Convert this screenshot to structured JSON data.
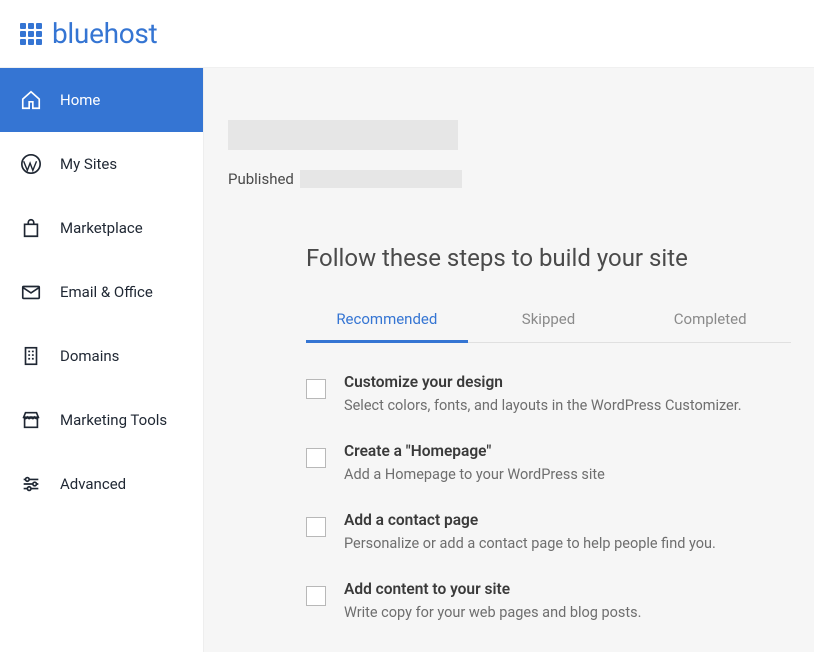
{
  "header": {
    "brand": "bluehost"
  },
  "sidebar": {
    "items": [
      {
        "label": "Home",
        "icon": "home-icon",
        "active": true
      },
      {
        "label": "My Sites",
        "icon": "wordpress-icon",
        "active": false
      },
      {
        "label": "Marketplace",
        "icon": "bag-icon",
        "active": false
      },
      {
        "label": "Email & Office",
        "icon": "envelope-icon",
        "active": false
      },
      {
        "label": "Domains",
        "icon": "building-icon",
        "active": false
      },
      {
        "label": "Marketing Tools",
        "icon": "storefront-icon",
        "active": false
      },
      {
        "label": "Advanced",
        "icon": "sliders-icon",
        "active": false
      }
    ]
  },
  "main": {
    "published_label": "Published",
    "steps_heading": "Follow these steps to build your site",
    "tabs": [
      {
        "label": "Recommended",
        "active": true
      },
      {
        "label": "Skipped",
        "active": false
      },
      {
        "label": "Completed",
        "active": false
      }
    ],
    "tasks": [
      {
        "title": "Customize your design",
        "desc": "Select colors, fonts, and layouts in the WordPress Customizer."
      },
      {
        "title": "Create a \"Homepage\"",
        "desc": "Add a Homepage to your WordPress site"
      },
      {
        "title": "Add a contact page",
        "desc": "Personalize or add a contact page to help people find you."
      },
      {
        "title": "Add content to your site",
        "desc": "Write copy for your web pages and blog posts."
      }
    ]
  }
}
